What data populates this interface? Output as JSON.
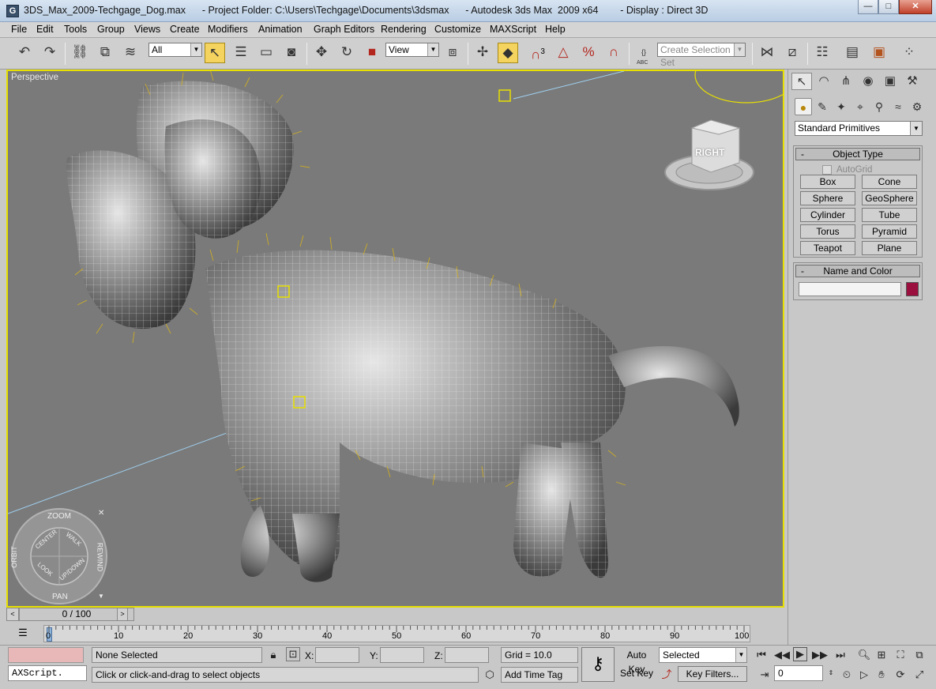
{
  "window": {
    "title": "3DS_Max_2009-Techgage_Dog.max      - Project Folder: C:\\Users\\Techgage\\Documents\\3dsmax      - Autodesk 3ds Max  2009 x64        - Display : Direct 3D",
    "app_icon": "G",
    "minimize": "—",
    "maximize": "□",
    "close": "✕"
  },
  "menu": [
    "File",
    "Edit",
    "Tools",
    "Group",
    "Views",
    "Create",
    "Modifiers",
    "Animation",
    "Graph Editors",
    "Rendering",
    "Customize",
    "MAXScript",
    "Help"
  ],
  "toolbar": {
    "filter_value": "All",
    "coord_system": "View",
    "named_selection_placeholder": "Create Selection Set",
    "snap_3": "3",
    "abc_label": "ABC"
  },
  "viewport": {
    "label": "Perspective",
    "viewcube_face": "RIGHT",
    "nav_wheel": {
      "top": "ZOOM",
      "left": "ORBIT",
      "right": "REWIND",
      "bottom": "PAN",
      "inner_center": "CENTER",
      "inner_walk": "WALK",
      "inner_look": "LOOK",
      "inner_updown": "UP/DOWN"
    }
  },
  "command_panel": {
    "category": "Standard Primitives",
    "object_type": {
      "title": "Object Type",
      "autogrid": "AutoGrid",
      "buttons": [
        "Box",
        "Cone",
        "Sphere",
        "GeoSphere",
        "Cylinder",
        "Tube",
        "Torus",
        "Pyramid",
        "Teapot",
        "Plane"
      ]
    },
    "name_and_color": {
      "title": "Name and Color",
      "color_swatch": "#9a0f3d"
    }
  },
  "timeline": {
    "slider_text": "0 / 100",
    "ticks": [
      "0",
      "10",
      "20",
      "30",
      "40",
      "50",
      "60",
      "70",
      "80",
      "90",
      "100"
    ]
  },
  "status": {
    "maxscript_listener": "AXScript.",
    "selection": "None Selected",
    "prompt": "Click or click-and-drag to select objects",
    "x_label": "X:",
    "y_label": "Y:",
    "z_label": "Z:",
    "grid": "Grid = 10.0",
    "add_time_tag": "Add Time Tag",
    "auto_key": "Auto Key",
    "set_key": "Set Key",
    "key_mode": "Selected",
    "key_filters": "Key Filters...",
    "frame": "0"
  },
  "colors": {
    "viewport_bg": "#7a7a7a",
    "active_border": "#e8e000",
    "accent_yellow": "#f4d35e"
  }
}
